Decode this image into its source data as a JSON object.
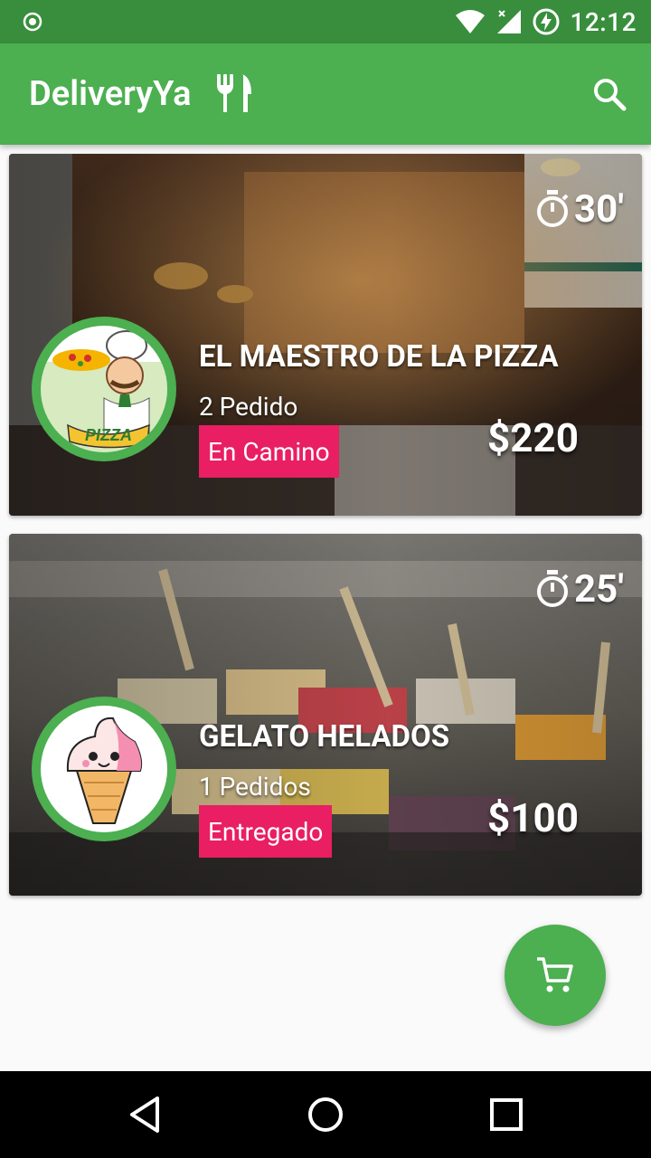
{
  "status_bar": {
    "time": "12:12"
  },
  "app_bar": {
    "title": "DeliveryYa"
  },
  "orders": [
    {
      "eta": "30'",
      "restaurant": "EL MAESTRO DE LA PIZZA",
      "count": "2 Pedido",
      "status": "En Camino",
      "price": "$220",
      "logo_text": "PIZZA"
    },
    {
      "eta": "25'",
      "restaurant": "GELATO HELADOS",
      "count": "1 Pedidos",
      "status": "Entregado",
      "price": "$100"
    }
  ],
  "colors": {
    "primary": "#4caf50",
    "primary_dark": "#388e3c",
    "accent": "#e91e63"
  }
}
